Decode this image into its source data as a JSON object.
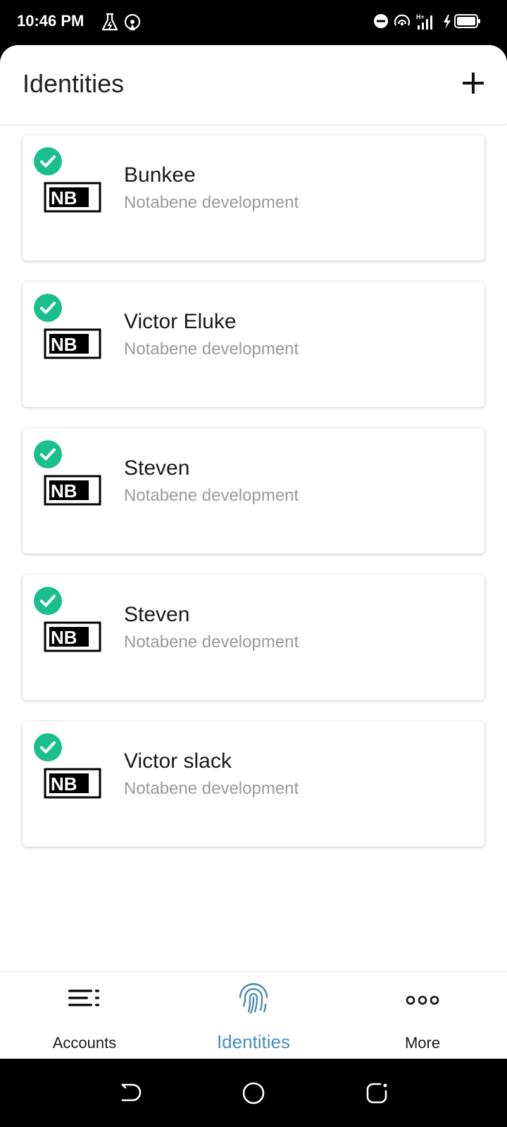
{
  "status_bar": {
    "time": "10:46 PM",
    "left_icons": [
      "lab-flask-icon",
      "hotspot-icon"
    ],
    "right_icons": [
      "do-not-disturb-icon",
      "hotspot-icon",
      "signal-icon",
      "battery-charging-icon"
    ]
  },
  "header": {
    "title": "Identities",
    "add_icon": "plus-icon"
  },
  "identities": [
    {
      "name": "Bunkee",
      "org": "Notabene development",
      "verified": true,
      "logo_text": "NB"
    },
    {
      "name": "Victor Eluke",
      "org": "Notabene development",
      "verified": true,
      "logo_text": "NB"
    },
    {
      "name": "Steven",
      "org": "Notabene development",
      "verified": true,
      "logo_text": "NB"
    },
    {
      "name": "Steven",
      "org": "Notabene development",
      "verified": true,
      "logo_text": "NB"
    },
    {
      "name": "Victor slack",
      "org": "Notabene development",
      "verified": true,
      "logo_text": "NB"
    }
  ],
  "bottom_nav": {
    "items": [
      {
        "label": "Accounts",
        "icon": "menu-lines-icon",
        "active": false
      },
      {
        "label": "Identities",
        "icon": "fingerprint-icon",
        "active": true
      },
      {
        "label": "More",
        "icon": "more-dots-icon",
        "active": false
      }
    ],
    "active_color": "#4a8db3"
  },
  "colors": {
    "check_green": "#1bbf8f",
    "text_primary": "#1a1a1a",
    "text_secondary": "#9a9a9a"
  },
  "system_nav": [
    "back-icon",
    "home-icon",
    "recents-icon"
  ]
}
